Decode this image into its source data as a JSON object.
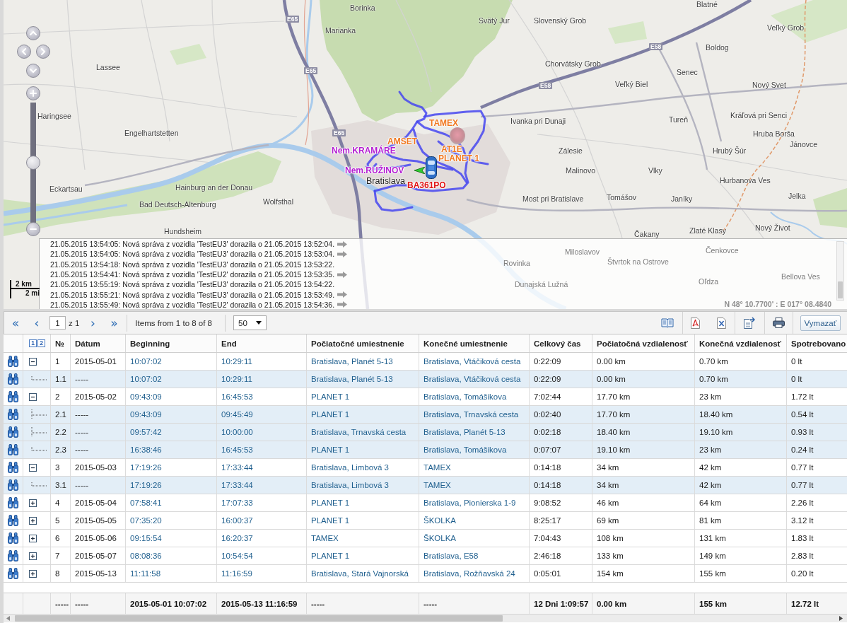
{
  "map": {
    "places": [
      {
        "name": "Borinka",
        "kind": "village"
      },
      {
        "name": "Blatné",
        "kind": "village"
      },
      {
        "name": "Svätý Jur",
        "kind": "village"
      },
      {
        "name": "Slovenský Grob",
        "kind": "village"
      },
      {
        "name": "Marianka",
        "kind": "village"
      },
      {
        "name": "Veľký Grob",
        "kind": "village"
      },
      {
        "name": "Boldog",
        "kind": "village"
      },
      {
        "name": "Lassee",
        "kind": "village"
      },
      {
        "name": "Chorvátsky Grob",
        "kind": "village"
      },
      {
        "name": "Senec",
        "kind": "village"
      },
      {
        "name": "Veľký Biel",
        "kind": "village"
      },
      {
        "name": "Nový Svet",
        "kind": "village"
      },
      {
        "name": "Haringsee",
        "kind": "village"
      },
      {
        "name": "Ivanka pri Dunaji",
        "kind": "village"
      },
      {
        "name": "Tureň",
        "kind": "village"
      },
      {
        "name": "Kráľová pri Senci",
        "kind": "village"
      },
      {
        "name": "Engelhartstetten",
        "kind": "village"
      },
      {
        "name": "Hruba Borša",
        "kind": "village"
      },
      {
        "name": "Zálesie",
        "kind": "village"
      },
      {
        "name": "Hrubý Šúr",
        "kind": "village"
      },
      {
        "name": "Jánovce",
        "kind": "village"
      },
      {
        "name": "Malinovo",
        "kind": "village"
      },
      {
        "name": "Vlky",
        "kind": "village"
      },
      {
        "name": "Eckartsau",
        "kind": "village"
      },
      {
        "name": "Hainburg an der Donau",
        "kind": "village"
      },
      {
        "name": "Bratislava",
        "kind": "city"
      },
      {
        "name": "Hurbanova Ves",
        "kind": "village"
      },
      {
        "name": "Bad Deutsch-Altenburg",
        "kind": "village"
      },
      {
        "name": "Wolfsthal",
        "kind": "village"
      },
      {
        "name": "Most pri Bratislave",
        "kind": "village"
      },
      {
        "name": "Tomášov",
        "kind": "village"
      },
      {
        "name": "Janíky",
        "kind": "village"
      },
      {
        "name": "Jelka",
        "kind": "village"
      },
      {
        "name": "Hundsheim",
        "kind": "village"
      },
      {
        "name": "Čakany",
        "kind": "village"
      },
      {
        "name": "Zlaté Klasy",
        "kind": "village"
      },
      {
        "name": "Nový Život",
        "kind": "village"
      },
      {
        "name": "Miloslavov",
        "kind": "village"
      },
      {
        "name": "Čenkovce",
        "kind": "village"
      },
      {
        "name": "Rovinka",
        "kind": "village"
      },
      {
        "name": "Štvrtok na Ostrove",
        "kind": "village"
      },
      {
        "name": "Dunajská Lužná",
        "kind": "village"
      },
      {
        "name": "Oľdza",
        "kind": "village"
      },
      {
        "name": "Bellova Ves",
        "kind": "village"
      }
    ],
    "road_shields": [
      "E65",
      "E58",
      "E65",
      "E58",
      "E65"
    ],
    "labels": [
      {
        "text": "TAMEX",
        "color": "#f07820"
      },
      {
        "text": "AMSET",
        "color": "#f07820"
      },
      {
        "text": "Nem.KRAMÁRE",
        "color": "#b41ed2"
      },
      {
        "text": "AT1E",
        "color": "#f07820"
      },
      {
        "text": "PLANET 1",
        "color": "#f07820"
      },
      {
        "text": "Nem.RUŽINOV",
        "color": "#b41ed2"
      },
      {
        "text": "BA361PO",
        "color": "#e01414"
      }
    ],
    "zoom_slider": {
      "level": 0.5
    },
    "scale": {
      "metric": "2 km",
      "imperial": "2 mi"
    },
    "log": [
      {
        "text": "21.05.2015 13:54:05: Nová správa z vozidla 'TestEU3' dorazila o 21.05.2015 13:52:04.",
        "arrow": true
      },
      {
        "text": "21.05.2015 13:54:05: Nová správa z vozidla 'TestEU3' dorazila o 21.05.2015 13:53:04.",
        "arrow": true
      },
      {
        "text": "21.05.2015 13:54:18: Nová správa z vozidla 'TestEU3' dorazila o 21.05.2015 13:53:22.",
        "arrow": false
      },
      {
        "text": "21.05.2015 13:54:41: Nová správa z vozidla 'TestEU2' dorazila o 21.05.2015 13:53:35.",
        "arrow": true
      },
      {
        "text": "21.05.2015 13:55:19: Nová správa z vozidla 'TestEU3' dorazila o 21.05.2015 13:54:22.",
        "arrow": false
      },
      {
        "text": "21.05.2015 13:55:21: Nová správa z vozidla 'TestEU3' dorazila o 21.05.2015 13:53:49.",
        "arrow": true
      },
      {
        "text": "21.05.2015 13:55:49: Nová správa z vozidla 'TestEU2' dorazila o 21.05.2015 13:54:36.",
        "arrow": true
      }
    ],
    "coordinates": "N 48° 10.7700' : E 017° 08.4840"
  },
  "pager": {
    "first": "«",
    "prev": "‹",
    "page": "1",
    "total": "z 1",
    "next": "›",
    "last": "»",
    "summary": "Items from 1 to 8 of 8",
    "page_size": "50"
  },
  "toolbar": {
    "clear_button": "Vymazať"
  },
  "table": {
    "level_buttons": [
      "1",
      "2"
    ],
    "columns": [
      "№",
      "Dátum",
      "Beginning",
      "End",
      "Počiatočné umiestnenie",
      "Konečné umiestnenie",
      "Celkový čas",
      "Počiatočná vzdialenosť",
      "Konečná vzdialenosť",
      "Spotrebovano"
    ],
    "rows": [
      {
        "cells": [
          "1",
          "2015-05-01",
          "10:07:02",
          "10:29:11",
          "Bratislava, Planét 5-13",
          "Bratislava, Vtáčiková cesta",
          "0:22:09",
          "0.00 km",
          "0.70 km",
          "0 lt"
        ],
        "expanded": true,
        "children": [
          {
            "cells": [
              "1.1",
              "-----",
              "10:07:02",
              "10:29:11",
              "Bratislava, Planét 5-13",
              "Bratislava, Vtáčiková cesta",
              "0:22:09",
              "0.00 km",
              "0.70 km",
              "0 lt"
            ]
          }
        ]
      },
      {
        "cells": [
          "2",
          "2015-05-02",
          "09:43:09",
          "16:45:53",
          "PLANET 1",
          "Bratislava, Tomášikova",
          "7:02:44",
          "17.70 km",
          "23 km",
          "1.72 lt"
        ],
        "expanded": true,
        "children": [
          {
            "cells": [
              "2.1",
              "-----",
              "09:43:09",
              "09:45:49",
              "PLANET 1",
              "Bratislava, Trnavská cesta",
              "0:02:40",
              "17.70 km",
              "18.40 km",
              "0.54 lt"
            ]
          },
          {
            "cells": [
              "2.2",
              "-----",
              "09:57:42",
              "10:00:00",
              "Bratislava, Trnavská cesta",
              "Bratislava, Planét 5-13",
              "0:02:18",
              "18.40 km",
              "19.10 km",
              "0.93 lt"
            ]
          },
          {
            "cells": [
              "2.3",
              "-----",
              "16:38:46",
              "16:45:53",
              "PLANET 1",
              "Bratislava, Tomášikova",
              "0:07:07",
              "19.10 km",
              "23 km",
              "0.24 lt"
            ]
          }
        ]
      },
      {
        "cells": [
          "3",
          "2015-05-03",
          "17:19:26",
          "17:33:44",
          "Bratislava, Limbová 3",
          "TAMEX",
          "0:14:18",
          "34 km",
          "42 km",
          "0.77 lt"
        ],
        "expanded": true,
        "children": [
          {
            "cells": [
              "3.1",
              "-----",
              "17:19:26",
              "17:33:44",
              "Bratislava, Limbová 3",
              "TAMEX",
              "0:14:18",
              "34 km",
              "42 km",
              "0.77 lt"
            ]
          }
        ]
      },
      {
        "cells": [
          "4",
          "2015-05-04",
          "07:58:41",
          "17:07:33",
          "PLANET 1",
          "Bratislava, Pionierska 1-9",
          "9:08:52",
          "46 km",
          "64 km",
          "2.26 lt"
        ],
        "expanded": false
      },
      {
        "cells": [
          "5",
          "2015-05-05",
          "07:35:20",
          "16:00:37",
          "PLANET 1",
          "ŠKOLKA",
          "8:25:17",
          "69 km",
          "81 km",
          "3.12 lt"
        ],
        "expanded": false
      },
      {
        "cells": [
          "6",
          "2015-05-06",
          "09:15:54",
          "16:20:37",
          "TAMEX",
          "ŠKOLKA",
          "7:04:43",
          "108 km",
          "131 km",
          "1.83 lt"
        ],
        "expanded": false
      },
      {
        "cells": [
          "7",
          "2015-05-07",
          "08:08:36",
          "10:54:54",
          "PLANET 1",
          "Bratislava, E58",
          "2:46:18",
          "133 km",
          "149 km",
          "2.83 lt"
        ],
        "expanded": false
      },
      {
        "cells": [
          "8",
          "2015-05-13",
          "11:11:58",
          "11:16:59",
          "Bratislava, Stará Vajnorská",
          "Bratislava, Rožňavská 24",
          "0:05:01",
          "154 km",
          "155 km",
          "0.20 lt"
        ],
        "expanded": false
      }
    ],
    "footer": [
      "-----",
      "-----",
      "2015-05-01 10:07:02",
      "2015-05-13 11:16:59",
      "-----",
      "-----",
      "12 Dni 1:09:57",
      "0.00 km",
      "155 km",
      "12.72 lt"
    ]
  }
}
